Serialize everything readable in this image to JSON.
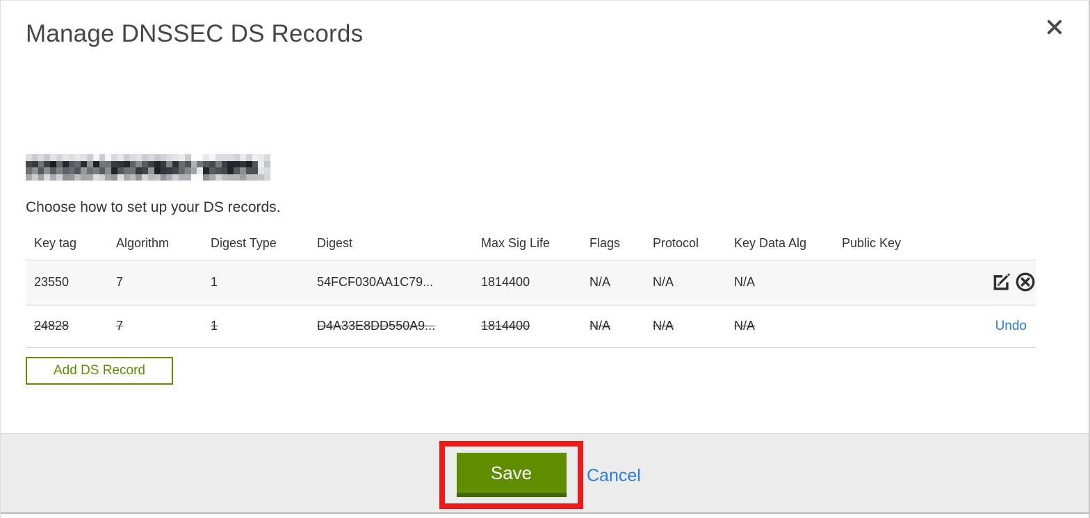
{
  "dialog": {
    "title": "Manage DNSSEC DS Records",
    "instruction": "Choose how to set up your DS records.",
    "add_button_label": "Add DS Record",
    "domain_redacted": true
  },
  "table": {
    "columns": [
      "Key tag",
      "Algorithm",
      "Digest Type",
      "Digest",
      "Max Sig Life",
      "Flags",
      "Protocol",
      "Key Data Alg",
      "Public Key"
    ],
    "rows": [
      {
        "cells": [
          "23550",
          "7",
          "1",
          "54FCF030AA1C79...",
          "1814400",
          "N/A",
          "N/A",
          "N/A",
          ""
        ],
        "deleted": false,
        "actions": [
          "edit-icon",
          "delete-icon"
        ]
      },
      {
        "cells": [
          "24828",
          "7",
          "1",
          "D4A33E8DD550A9...",
          "1814400",
          "N/A",
          "N/A",
          "N/A",
          ""
        ],
        "deleted": true,
        "undo_label": "Undo"
      }
    ]
  },
  "footer": {
    "save_label": "Save",
    "cancel_label": "Cancel"
  },
  "colors": {
    "accent_green": "#5e8d00",
    "accent_green_dark": "#44660a",
    "outline_green": "#5f8e00",
    "link_blue": "#2e7ce2",
    "annotation_red": "#ec1b1b",
    "row_highlight": "#f7f7f7",
    "footer_bg": "#ececec"
  }
}
